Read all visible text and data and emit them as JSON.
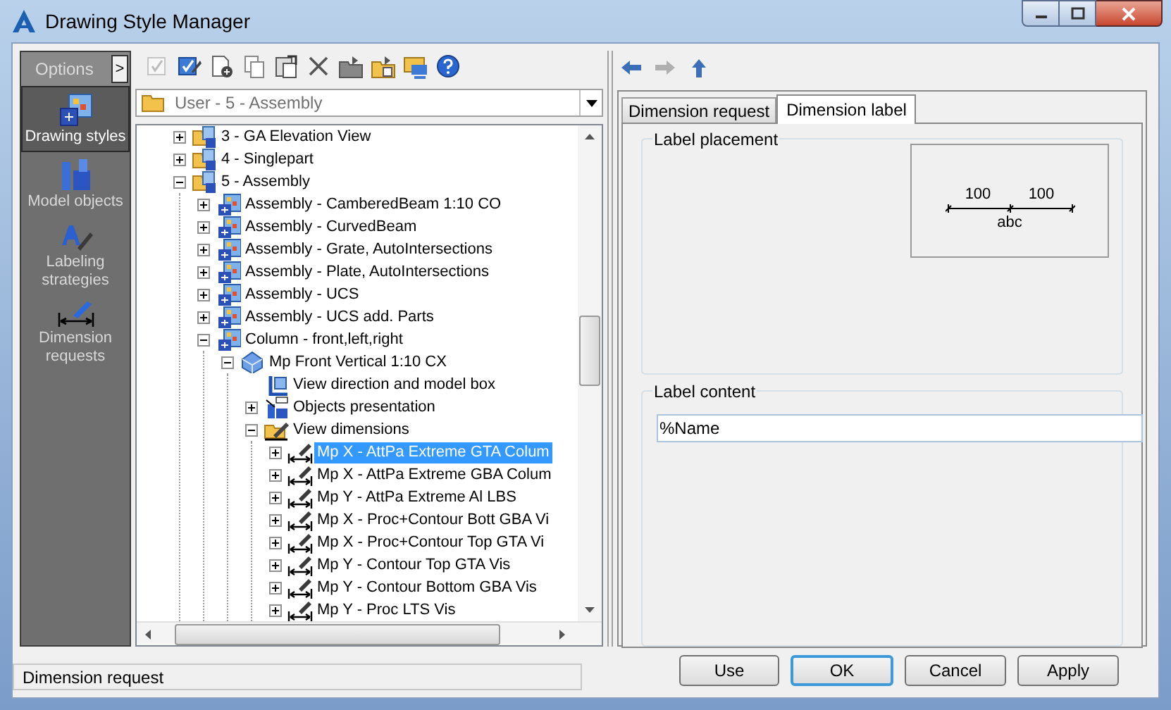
{
  "window": {
    "title": "Drawing Style Manager"
  },
  "sidebar": {
    "header": "Options",
    "toggle": ">",
    "items": [
      {
        "kind": "styles",
        "label": "Drawing styles",
        "selected": true
      },
      {
        "kind": "objects",
        "label": "Model objects",
        "selected": false
      },
      {
        "kind": "labeling",
        "label": "Labeling strategies",
        "selected": false
      },
      {
        "kind": "dimension",
        "label": "Dimension requests",
        "selected": false
      }
    ]
  },
  "toolbar": [
    {
      "kind": "check",
      "disabled": true
    },
    {
      "kind": "edit",
      "disabled": false
    },
    {
      "kind": "new",
      "disabled": false
    },
    {
      "kind": "copy",
      "disabled": false
    },
    {
      "kind": "paste",
      "disabled": false
    },
    {
      "kind": "delete",
      "disabled": false
    },
    {
      "kind": "folder-export",
      "disabled": false
    },
    {
      "kind": "folder-import",
      "disabled": false
    },
    {
      "kind": "preview",
      "disabled": false
    },
    {
      "kind": "help",
      "disabled": false
    }
  ],
  "location": {
    "value": "User - 5 - Assembly"
  },
  "tree": [
    {
      "label": "3 - GA Elevation View",
      "kind": "style-folder",
      "expanded": false,
      "selected": false
    },
    {
      "label": "4 - Singlepart",
      "kind": "style-folder",
      "expanded": false,
      "selected": false
    },
    {
      "label": "5 - Assembly",
      "kind": "style-folder",
      "expanded": true,
      "selected": false,
      "children": [
        {
          "label": "Assembly - CamberedBeam 1:10 CO",
          "kind": "style",
          "expanded": false,
          "selected": false
        },
        {
          "label": "Assembly - CurvedBeam",
          "kind": "style",
          "expanded": false,
          "selected": false
        },
        {
          "label": "Assembly - Grate, AutoIntersections",
          "kind": "style",
          "expanded": false,
          "selected": false
        },
        {
          "label": "Assembly - Plate, AutoIntersections",
          "kind": "style",
          "expanded": false,
          "selected": false
        },
        {
          "label": "Assembly - UCS",
          "kind": "style",
          "expanded": false,
          "selected": false
        },
        {
          "label": "Assembly - UCS add. Parts",
          "kind": "style",
          "expanded": false,
          "selected": false
        },
        {
          "label": "Column - front,left,right",
          "kind": "style",
          "expanded": true,
          "selected": false,
          "children": [
            {
              "label": "Mp Front Vertical 1:10 CX",
              "kind": "view",
              "expanded": true,
              "selected": false,
              "children": [
                {
                  "label": "View direction and model box",
                  "kind": "view-box",
                  "selected": false
                },
                {
                  "label": "Objects presentation",
                  "kind": "objects",
                  "expanded": false,
                  "selected": false
                },
                {
                  "label": "View dimensions",
                  "kind": "dimensions-folder",
                  "expanded": true,
                  "selected": false,
                  "children": [
                    {
                      "label": "Mp X - AttPa Extreme GTA Colum",
                      "kind": "dimension",
                      "expanded": false,
                      "selected": true
                    },
                    {
                      "label": "Mp X - AttPa Extreme GBA Colum",
                      "kind": "dimension",
                      "expanded": false,
                      "selected": false
                    },
                    {
                      "label": "Mp Y - AttPa Extreme Al LBS",
                      "kind": "dimension",
                      "expanded": false,
                      "selected": false
                    },
                    {
                      "label": "Mp X - Proc+Contour Bott GBA Vi",
                      "kind": "dimension",
                      "expanded": false,
                      "selected": false
                    },
                    {
                      "label": "Mp X - Proc+Contour Top GTA Vi",
                      "kind": "dimension",
                      "expanded": false,
                      "selected": false
                    },
                    {
                      "label": "Mp Y - Contour Top GTA Vis",
                      "kind": "dimension",
                      "expanded": false,
                      "selected": false
                    },
                    {
                      "label": "Mp Y - Contour Bottom GBA Vis",
                      "kind": "dimension",
                      "expanded": false,
                      "selected": false
                    },
                    {
                      "label": "Mp Y - Proc LTS Vis",
                      "kind": "dimension",
                      "expanded": false,
                      "selected": false
                    }
                  ]
                }
              ]
            }
          ]
        }
      ]
    }
  ],
  "navigation": [
    {
      "kind": "back",
      "disabled": false
    },
    {
      "kind": "forward",
      "disabled": true
    },
    {
      "kind": "up",
      "disabled": false
    }
  ],
  "tabs": [
    {
      "label": "Dimension request",
      "selected": false
    },
    {
      "label": "Dimension label",
      "selected": true
    }
  ],
  "label_placement": {
    "title": "Label placement",
    "preview": {
      "left_value": "100",
      "right_value": "100",
      "label": "abc"
    }
  },
  "label_content": {
    "title": "Label content",
    "value": "%Name"
  },
  "status_bar": {
    "text": "Dimension request"
  },
  "buttons": [
    {
      "label": "Use",
      "default": false
    },
    {
      "label": "OK",
      "default": true
    },
    {
      "label": "Cancel",
      "default": false
    },
    {
      "label": "Apply",
      "default": false
    }
  ]
}
